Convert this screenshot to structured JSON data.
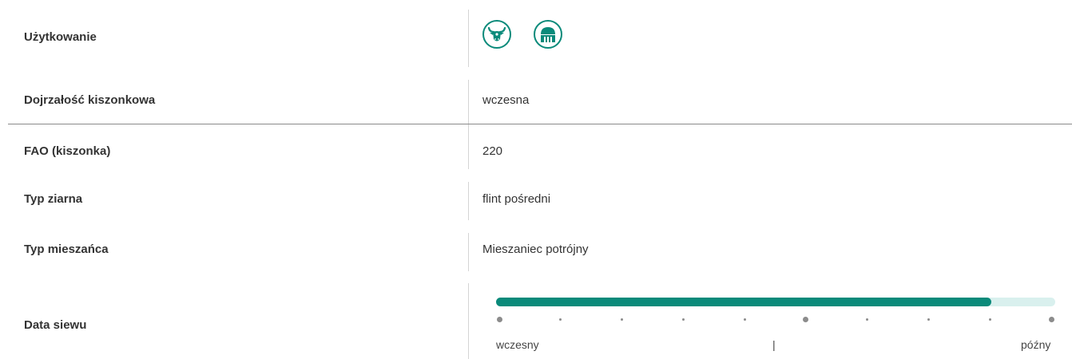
{
  "colors": {
    "accent": "#0a8a7a",
    "track": "#d9f0ee",
    "dot": "#8c8c8c",
    "divider": "#d4d4d4"
  },
  "rows": [
    {
      "label": "Użytkowanie",
      "value": "",
      "icons": [
        "cow-icon",
        "silo-icon"
      ]
    },
    {
      "label": "Dojrzałość kiszonkowa",
      "value": "wczesna"
    },
    {
      "label": "FAO (kiszonka)",
      "value": "220"
    },
    {
      "label": "Typ ziarna",
      "value": "flint pośredni"
    },
    {
      "label": "Typ mieszańca",
      "value": "Mieszaniec potrójny"
    },
    {
      "label": "Data siewu",
      "value": ""
    }
  ],
  "sowing_scale": {
    "level": 0.885,
    "tick_count": 10,
    "major_ticks": [
      0,
      5,
      9
    ],
    "left_label": "wczesny",
    "middle_label": "|",
    "right_label": "późny"
  }
}
